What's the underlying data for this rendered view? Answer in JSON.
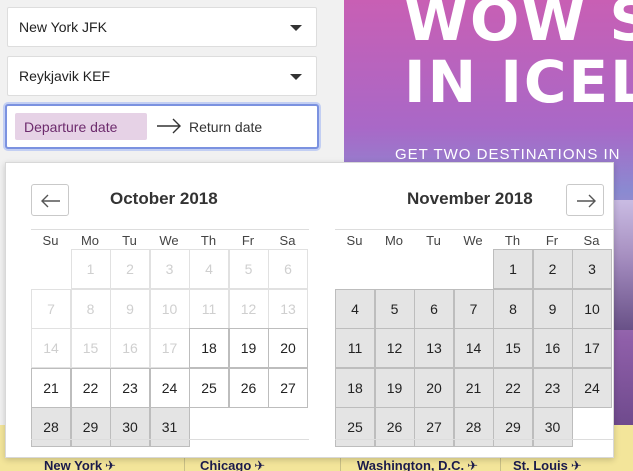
{
  "search_form": {
    "origin_value": "New York JFK",
    "destination_value": "Reykjavik KEF",
    "departure_label": "Departure date",
    "return_label": "Return date"
  },
  "promo_banner": {
    "line1": "WOW S",
    "line2": "IN ICELA",
    "line3": "GET TWO DESTINATIONS IN"
  },
  "cities": [
    {
      "name": "New York",
      "icon": "plane-icon"
    },
    {
      "name": "Chicago",
      "icon": "plane-icon"
    },
    {
      "name": "Washington, D.C.",
      "icon": "plane-icon"
    },
    {
      "name": "St. Louis",
      "icon": "plane-icon"
    }
  ],
  "calendar": {
    "prev_icon": "arrow-left-icon",
    "next_icon": "arrow-right-icon",
    "weekday_labels": [
      "Su",
      "Mo",
      "Tu",
      "We",
      "Th",
      "Fr",
      "Sa"
    ],
    "months": [
      {
        "title": "October 2018",
        "first_weekday": 1,
        "days": 31,
        "disabled_through": 17,
        "shaded_from": 28
      },
      {
        "title": "November 2018",
        "first_weekday": 4,
        "days": 30,
        "disabled_through": 0,
        "shaded_from": 1
      }
    ]
  },
  "colors": {
    "accent_border": "#7b92e0",
    "departure_chip": "#e6d2e6",
    "departure_text": "#6d2b6d",
    "shaded_day": "#e4e4e4",
    "city_strip": "#f3e59a"
  }
}
